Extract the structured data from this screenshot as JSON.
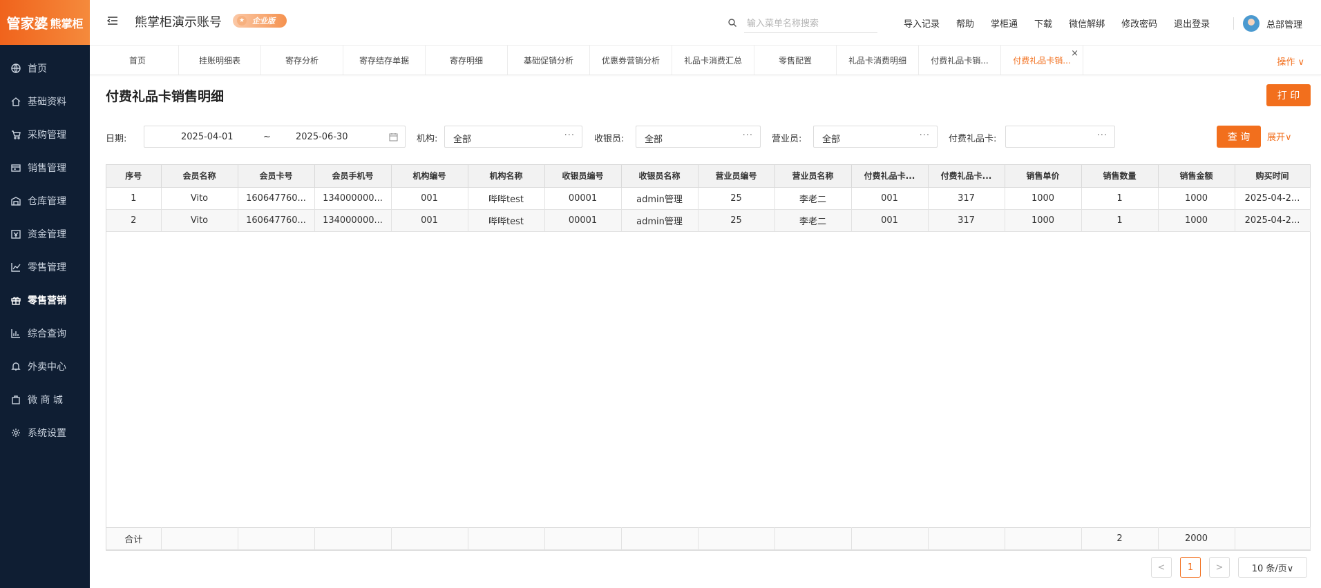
{
  "brand": {
    "logo_main": "管家婆",
    "logo_sub": "熊掌柜"
  },
  "sidebar": {
    "items": [
      {
        "label": "首页",
        "icon": "globe-icon"
      },
      {
        "label": "基础资料",
        "icon": "home-icon"
      },
      {
        "label": "采购管理",
        "icon": "cart-icon"
      },
      {
        "label": "销售管理",
        "icon": "receipt-icon"
      },
      {
        "label": "仓库管理",
        "icon": "warehouse-icon"
      },
      {
        "label": "资金管理",
        "icon": "wallet-icon"
      },
      {
        "label": "零售管理",
        "icon": "chart-icon"
      },
      {
        "label": "零售营销",
        "icon": "gift-icon",
        "active": true
      },
      {
        "label": "综合查询",
        "icon": "bar-chart-icon"
      },
      {
        "label": "外卖中心",
        "icon": "bell-icon"
      },
      {
        "label": "微 商 城",
        "icon": "bag-icon"
      },
      {
        "label": "系统设置",
        "icon": "gear-icon"
      }
    ]
  },
  "header": {
    "account": "熊掌柜演示账号",
    "edition_badge": "企业版",
    "search_placeholder": "输入菜单名称搜索",
    "links": [
      "导入记录",
      "帮助",
      "掌柜通",
      "下载",
      "微信解绑",
      "修改密码",
      "退出登录"
    ],
    "user_name": "总部管理"
  },
  "tabs": {
    "items": [
      "首页",
      "挂账明细表",
      "寄存分析",
      "寄存结存单据",
      "寄存明细",
      "基础促销分析",
      "优惠券营销分析",
      "礼品卡消费汇总",
      "零售配置",
      "礼品卡消费明细",
      "付费礼品卡销...",
      "付费礼品卡销..."
    ],
    "active_index": 11,
    "ops_label": "操作 ∨"
  },
  "page": {
    "title": "付费礼品卡销售明细",
    "print_label": "打 印",
    "query_label": "查 询",
    "expand_label": "展开∨"
  },
  "filters": {
    "date_label": "日期:",
    "date_start": "2025-04-01",
    "date_sep": "~",
    "date_end": "2025-06-30",
    "org_label": "机构:",
    "org_value": "全部",
    "cashier_label": "收银员:",
    "cashier_value": "全部",
    "clerk_label": "营业员:",
    "clerk_value": "全部",
    "card_label": "付费礼品卡:",
    "card_value": ""
  },
  "table": {
    "columns": [
      "序号",
      "会员名称",
      "会员卡号",
      "会员手机号",
      "机构编号",
      "机构名称",
      "收银员编号",
      "收银员名称",
      "营业员编号",
      "营业员名称",
      "付费礼品卡...",
      "付费礼品卡...",
      "销售单价",
      "销售数量",
      "销售金额",
      "购买时间"
    ],
    "rows": [
      [
        "1",
        "Vito",
        "160647760...",
        "134000000...",
        "001",
        "哔哔test",
        "00001",
        "admin管理",
        "25",
        "李老二",
        "001",
        "317",
        "1000",
        "1",
        "1000",
        "2025-04-2..."
      ],
      [
        "2",
        "Vito",
        "160647760...",
        "134000000...",
        "001",
        "哔哔test",
        "00001",
        "admin管理",
        "25",
        "李老二",
        "001",
        "317",
        "1000",
        "1",
        "1000",
        "2025-04-2..."
      ]
    ],
    "footer": [
      "合计",
      "",
      "",
      "",
      "",
      "",
      "",
      "",
      "",
      "",
      "",
      "",
      "",
      "2",
      "2000",
      ""
    ]
  },
  "pagination": {
    "prev": "<",
    "current": "1",
    "next": ">",
    "page_size": "10 条/页∨"
  },
  "colors": {
    "accent": "#f26f1d",
    "sidebar_bg": "#0f1e33"
  }
}
